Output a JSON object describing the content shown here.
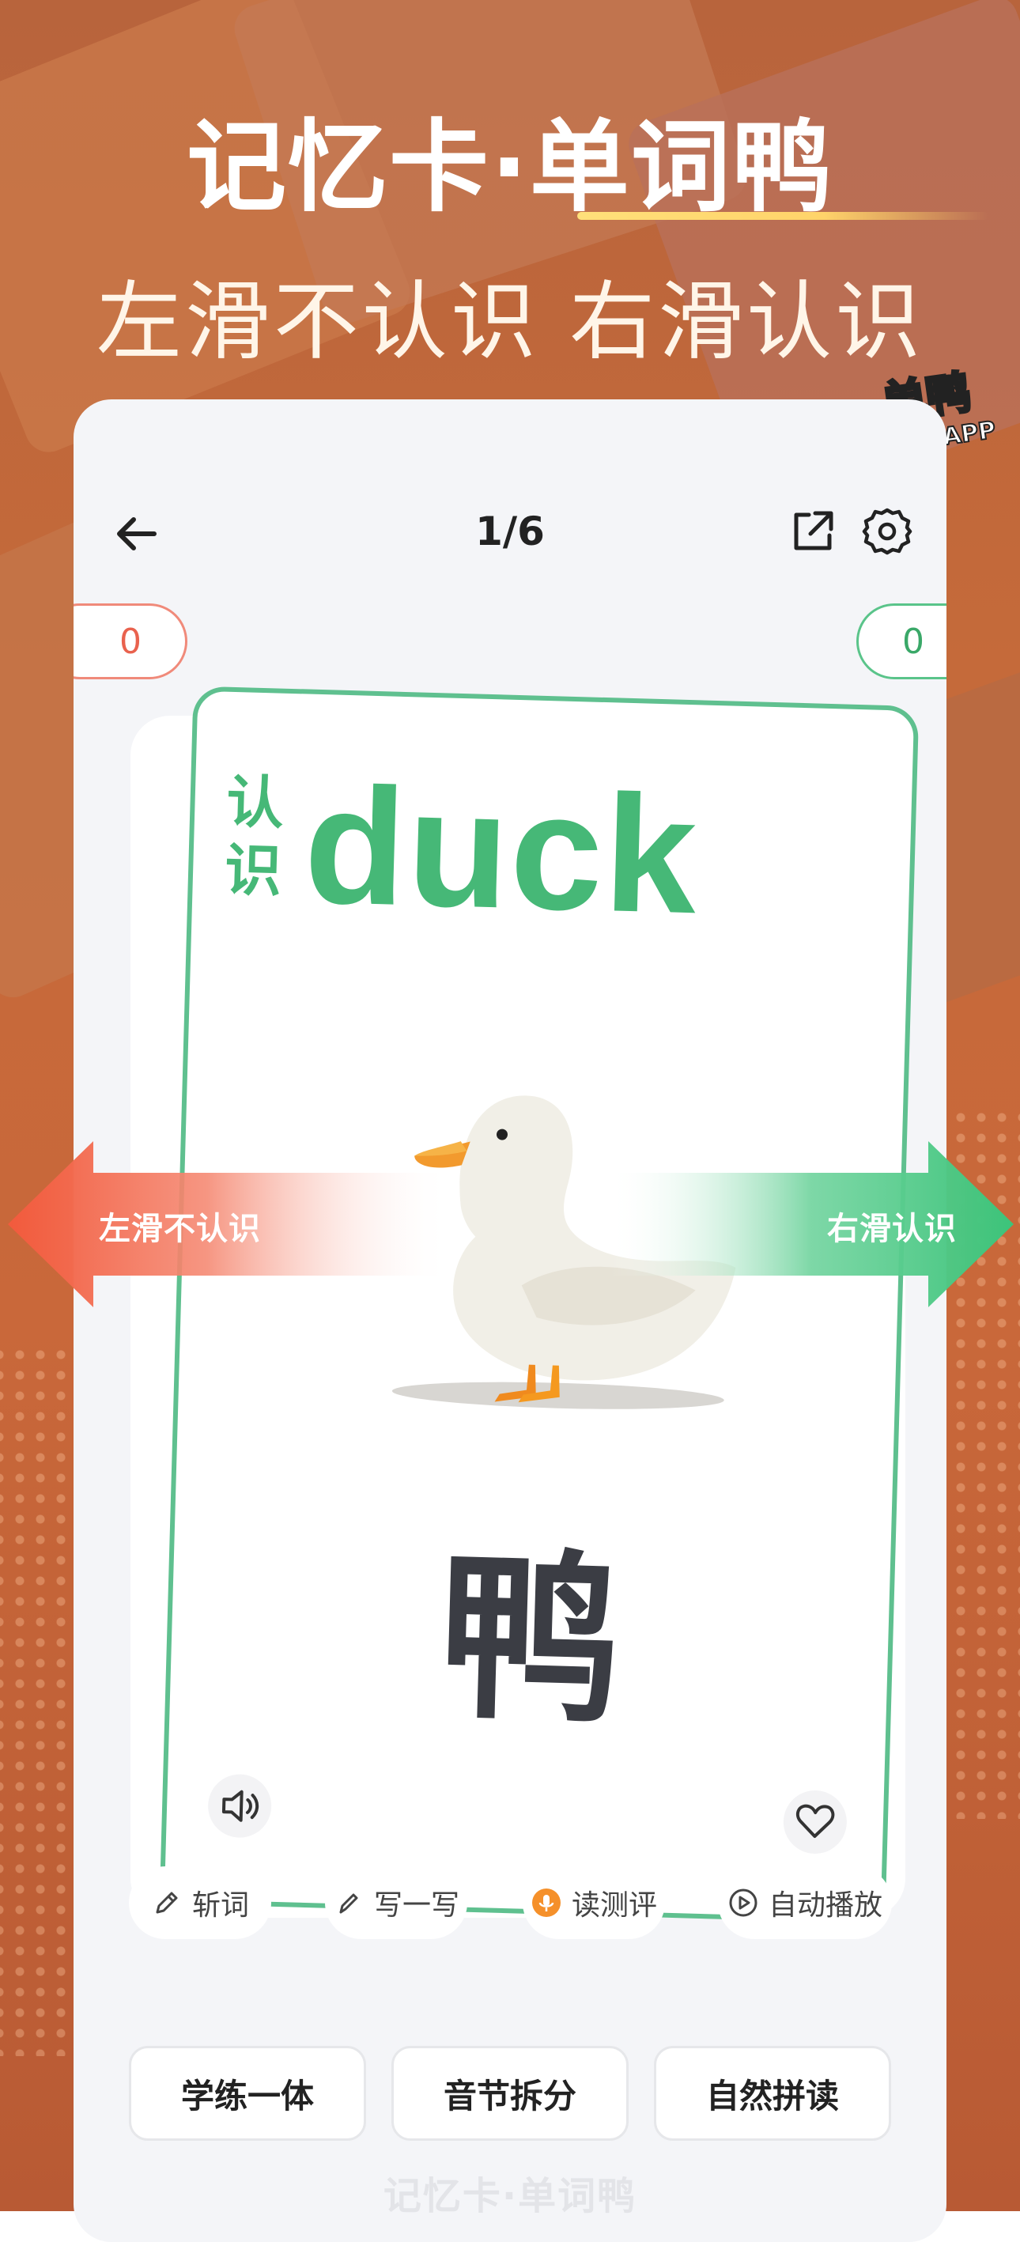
{
  "promo": {
    "headline": "记忆卡·单词鸭",
    "subline": "左滑不认识 右滑认识",
    "logo": {
      "line1": "单鸭",
      "line2": "词",
      "line3": "APP"
    }
  },
  "header": {
    "page_counter": "1/6",
    "back_icon": "arrow-left-icon",
    "share_icon": "share-external-icon",
    "settings_icon": "gear-icon"
  },
  "counters": {
    "unknown": "0",
    "known": "0"
  },
  "card": {
    "status_tag": "认识",
    "word_en": "duck",
    "word_zh": "鸭",
    "image": "duck-illustration"
  },
  "swipe_hints": {
    "left": "左滑不认识",
    "right": "右滑认识"
  },
  "chips": [
    {
      "label": "斩词",
      "icon": "pencil-icon"
    },
    {
      "label": "写一写",
      "icon": "pen-icon"
    },
    {
      "label": "读测评",
      "icon": "microphone-icon"
    },
    {
      "label": "自动播放",
      "icon": "play-circle-icon"
    }
  ],
  "actions": [
    "学练一体",
    "音节拆分",
    "自然拼读"
  ],
  "watermark": "记忆卡·单词鸭",
  "colors": {
    "known": "#46b877",
    "unknown": "#e9624e",
    "background": "#c56a3a"
  }
}
